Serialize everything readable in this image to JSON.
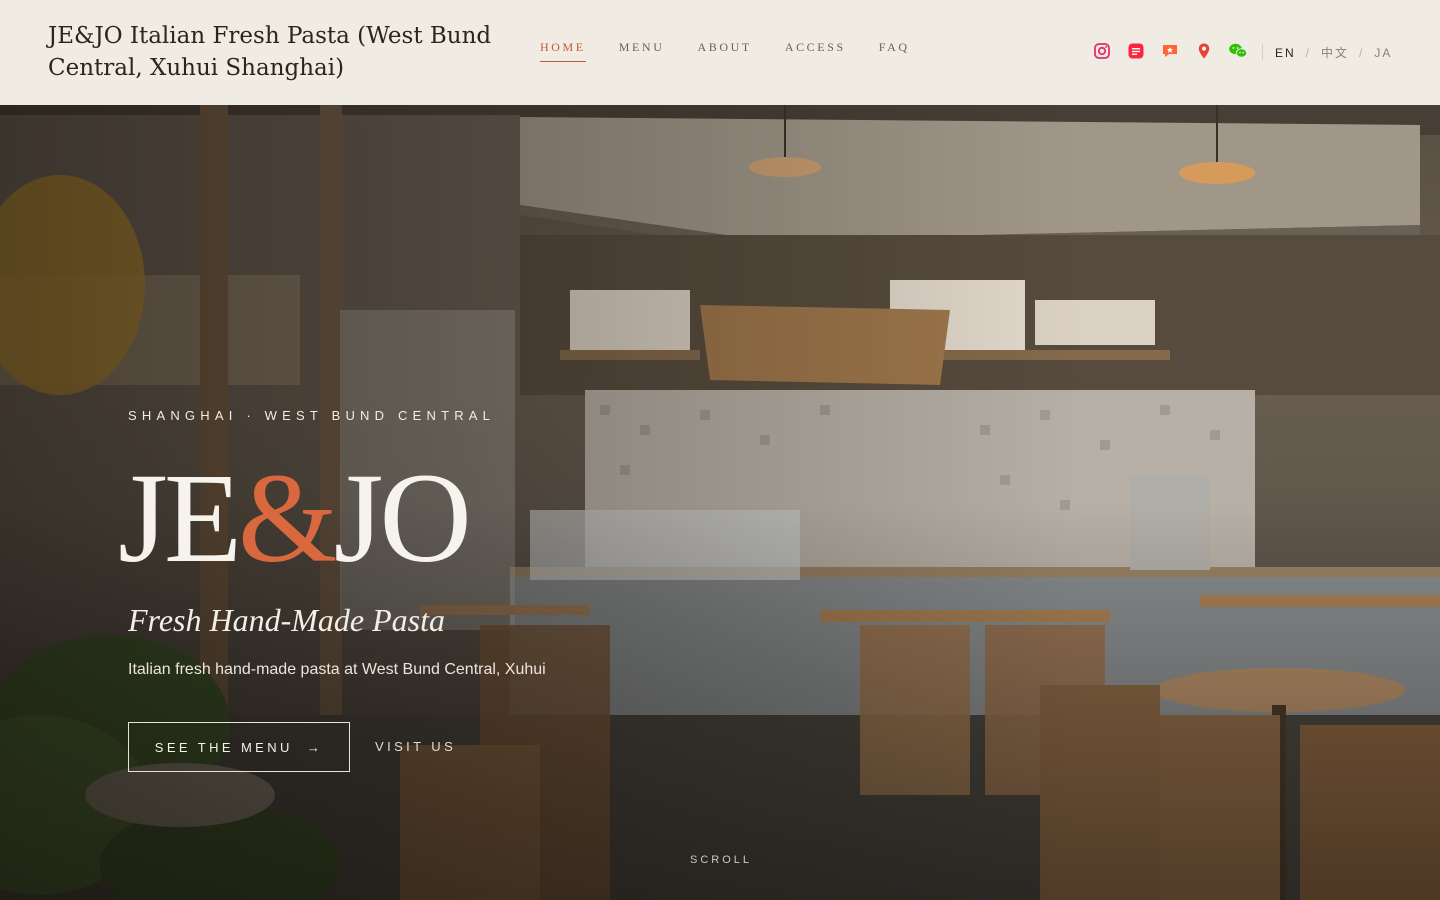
{
  "header": {
    "brand": "JE&JO Italian Fresh Pasta (West Bund Central, Xuhui Shanghai)",
    "nav": [
      {
        "label": "HOME",
        "active": true
      },
      {
        "label": "MENU",
        "active": false
      },
      {
        "label": "ABOUT",
        "active": false
      },
      {
        "label": "ACCESS",
        "active": false
      },
      {
        "label": "FAQ",
        "active": false
      }
    ],
    "social_icons": [
      "instagram-icon",
      "xiaohongshu-icon",
      "dianping-icon",
      "map-pin-icon",
      "wechat-icon"
    ],
    "languages": [
      "EN",
      "中文",
      "JA"
    ],
    "current_language": "EN"
  },
  "hero": {
    "eyebrow": "SHANGHAI · WEST BUND CENTRAL",
    "logo_left": "JE",
    "logo_amp": "&",
    "logo_right": "JO",
    "tagline": "Fresh Hand-Made Pasta",
    "description": "Italian fresh hand-made pasta at West Bund Central, Xuhui",
    "primary_button": "SEE THE MENU",
    "primary_button_arrow": "→",
    "secondary_button": "VISIT US",
    "scroll_label": "SCROLL"
  },
  "colors": {
    "accent": "#c25a3a",
    "logo_amp": "#d9683f",
    "header_bg": "#f0ebe3",
    "instagram": "#e1306c",
    "xiaohongshu": "#ff2442",
    "dianping": "#ff6633",
    "map": "#ea4335",
    "wechat": "#2dc100"
  }
}
